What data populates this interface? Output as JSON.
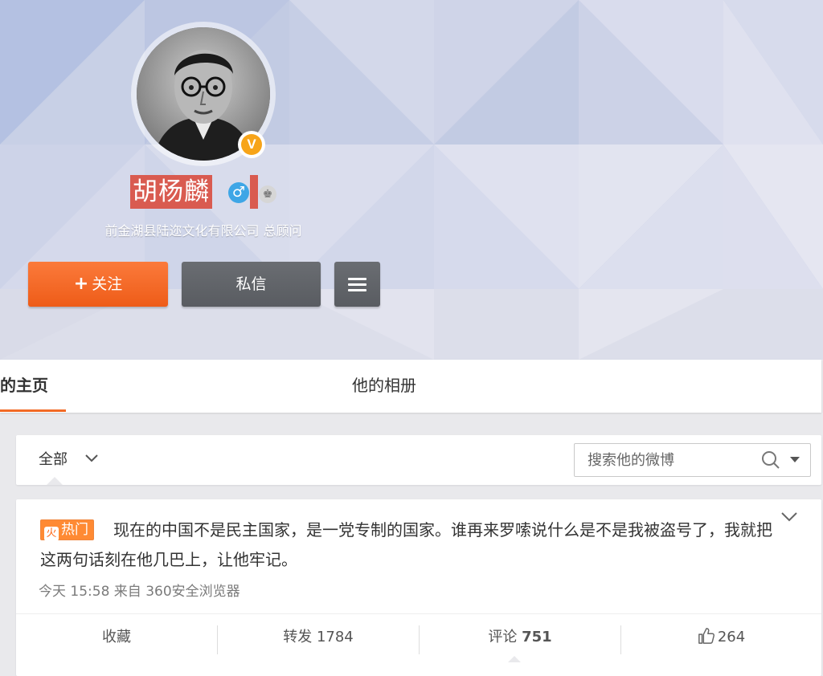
{
  "profile": {
    "name": "胡杨麟",
    "gender_symbol": "♂",
    "verified_symbol": "V",
    "crown_symbol": "♚",
    "title": "前金湖县陆迩文化有限公司 总顾问"
  },
  "actions": {
    "follow_plus": "+",
    "follow_label": "关注",
    "message_label": "私信"
  },
  "tabs": {
    "home": "的主页",
    "album": "他的相册"
  },
  "filter": {
    "all_label": "全部",
    "chevron": "⌄",
    "search_placeholder": "搜索他的微博"
  },
  "post": {
    "hot_label": "热门",
    "flame": "火",
    "text": "现在的中国不是民主国家，是一党专制的国家。谁再来罗嗦说什么是不是我被盗号了，我就把这两句话刻在他几巴上，让他牢记。",
    "expand": "⌄",
    "meta": "今天 15:58 来自 360安全浏览器",
    "favorite": "收藏",
    "repost": "转发 1784",
    "comment_label": "评论 ",
    "comment_count": "751",
    "likes": "264"
  },
  "colors": {
    "accent_orange": "#f26a26",
    "name_highlight": "#d95b50",
    "verified_gold": "#f7a419",
    "gender_blue": "#3ea6e6"
  }
}
